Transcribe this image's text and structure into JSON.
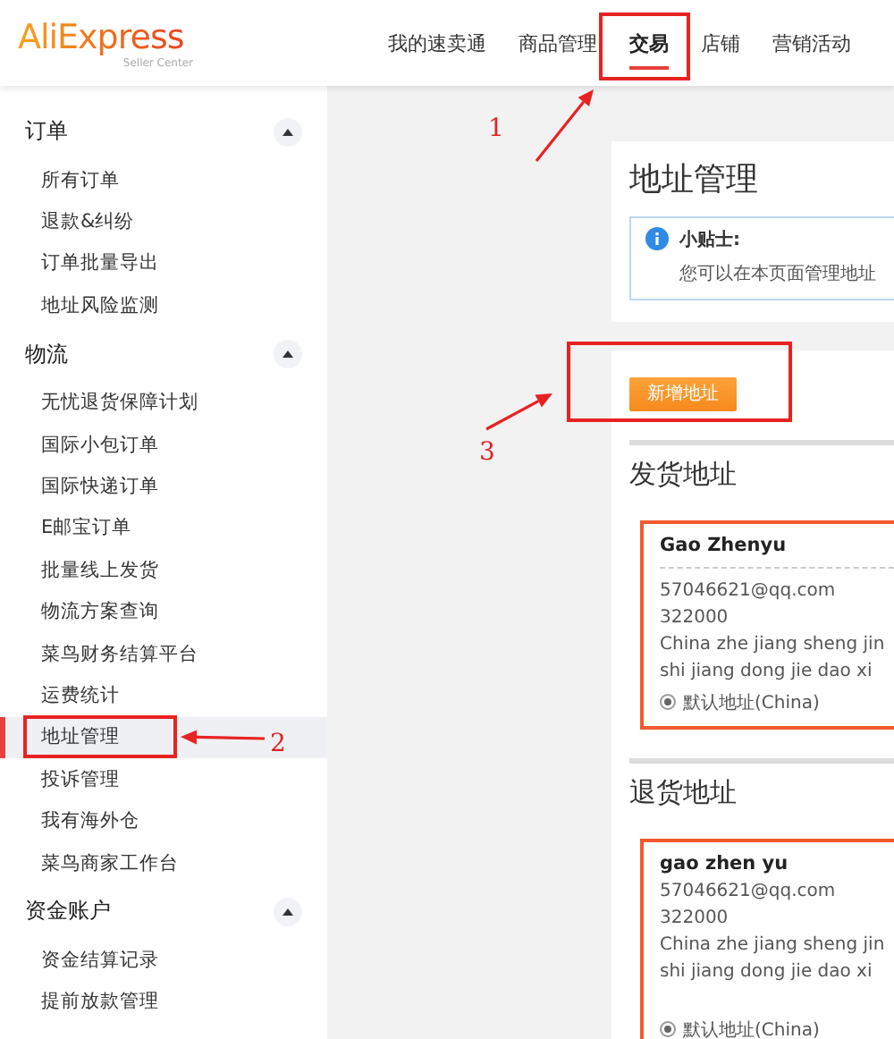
{
  "header": {
    "logo": "AliExpress",
    "logo_subtitle": "Seller Center",
    "nav": [
      {
        "label": "我的速卖通",
        "selected": false
      },
      {
        "label": "商品管理",
        "selected": false
      },
      {
        "label": "交易",
        "selected": true
      },
      {
        "label": "店铺",
        "selected": false
      },
      {
        "label": "营销活动",
        "selected": false
      }
    ]
  },
  "sidebar": {
    "sections": [
      {
        "title": "订单",
        "expanded": true,
        "items": [
          {
            "label": "所有订单",
            "selected": false
          },
          {
            "label": "退款&纠纷",
            "selected": false
          },
          {
            "label": "订单批量导出",
            "selected": false
          },
          {
            "label": "地址风险监测",
            "selected": false
          }
        ]
      },
      {
        "title": "物流",
        "expanded": true,
        "items": [
          {
            "label": "无忧退货保障计划",
            "selected": false
          },
          {
            "label": "国际小包订单",
            "selected": false
          },
          {
            "label": "国际快递订单",
            "selected": false
          },
          {
            "label": "E邮宝订单",
            "selected": false
          },
          {
            "label": "批量线上发货",
            "selected": false
          },
          {
            "label": "物流方案查询",
            "selected": false
          },
          {
            "label": "菜鸟财务结算平台",
            "selected": false
          },
          {
            "label": "运费统计",
            "selected": false
          },
          {
            "label": "地址管理",
            "selected": true
          },
          {
            "label": "投诉管理",
            "selected": false
          },
          {
            "label": "我有海外仓",
            "selected": false
          },
          {
            "label": "菜鸟商家工作台",
            "selected": false
          }
        ]
      },
      {
        "title": "资金账户",
        "expanded": true,
        "items": [
          {
            "label": "资金结算记录",
            "selected": false
          },
          {
            "label": "提前放款管理",
            "selected": false
          }
        ]
      }
    ]
  },
  "page": {
    "title": "地址管理",
    "tip": {
      "title": "小贴士:",
      "text": "您可以在本页面管理地址"
    },
    "add_button": "新增地址",
    "address_groups": [
      {
        "heading": "发货地址",
        "cards": [
          {
            "name": "Gao Zhenyu",
            "name_divider": true,
            "email": "57046621@qq.com",
            "zip": "322000",
            "address_lines": [
              "China zhe jiang sheng jin",
              "shi jiang dong jie dao xi"
            ],
            "default_label": "默认地址(China)",
            "default": true
          }
        ]
      },
      {
        "heading": "退货地址",
        "cards": [
          {
            "name": "gao zhen yu",
            "name_divider": false,
            "email": "57046621@qq.com",
            "zip": "322000",
            "address_lines": [
              "China zhe jiang sheng jin",
              "shi jiang dong jie dao xi"
            ],
            "default_label": "默认地址(China)",
            "default": true
          }
        ]
      }
    ]
  },
  "annotations": [
    {
      "number": "1"
    },
    {
      "number": "2"
    },
    {
      "number": "3"
    }
  ]
}
